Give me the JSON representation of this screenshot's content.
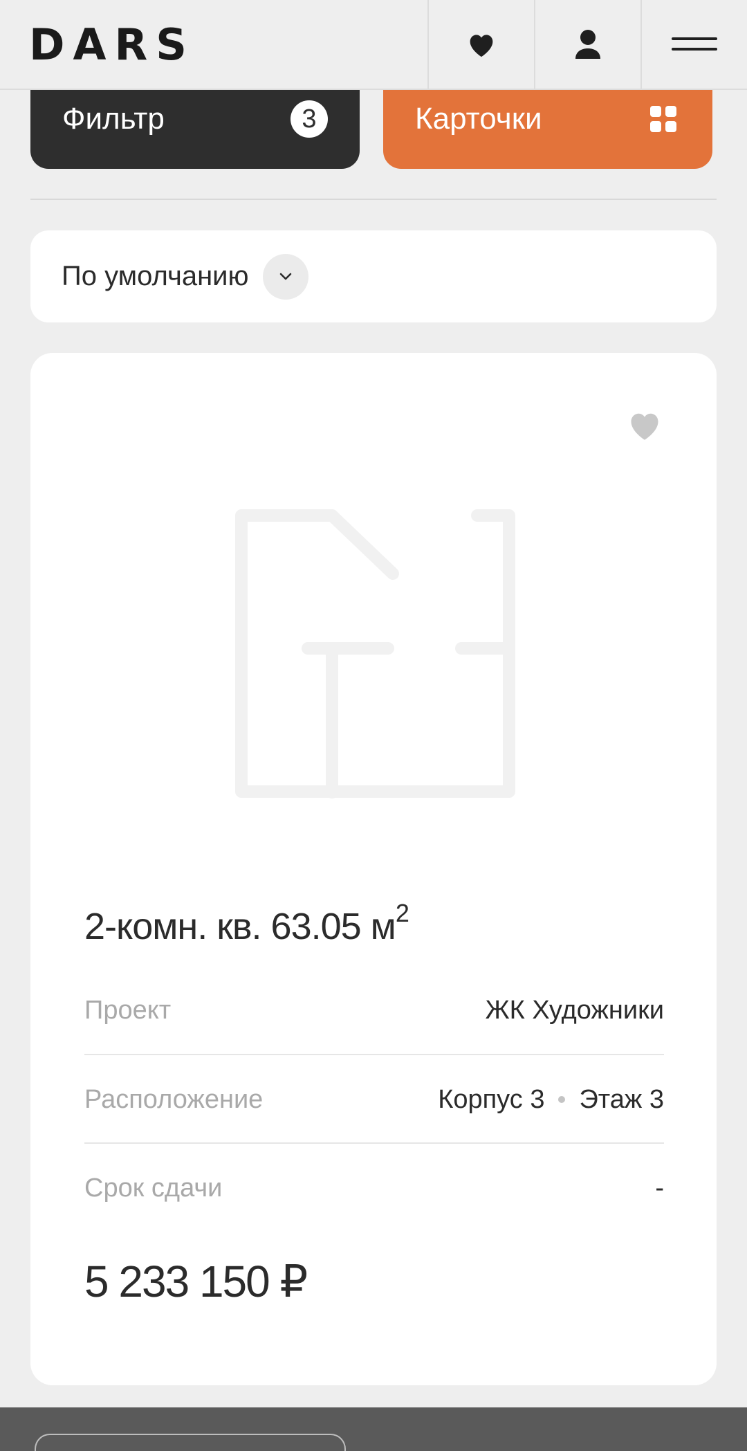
{
  "header": {
    "logo": "DARS",
    "icons": [
      "heart-icon",
      "user-icon",
      "menu-icon"
    ]
  },
  "toolbar": {
    "filter_label": "Фильтр",
    "filter_count": "3",
    "cards_label": "Карточки",
    "accent_color": "#e3733a"
  },
  "sort": {
    "label": "По умолчанию"
  },
  "card": {
    "title": "2-комн. кв. 63.05 м",
    "title_sup": "2",
    "rows": [
      {
        "label": "Проект",
        "value": "ЖК Художники"
      },
      {
        "label": "Расположение",
        "building": "Корпус 3",
        "floor": "Этаж 3"
      },
      {
        "label": "Срок сдачи",
        "value": "-"
      }
    ],
    "price": "5 233 150 ₽"
  }
}
